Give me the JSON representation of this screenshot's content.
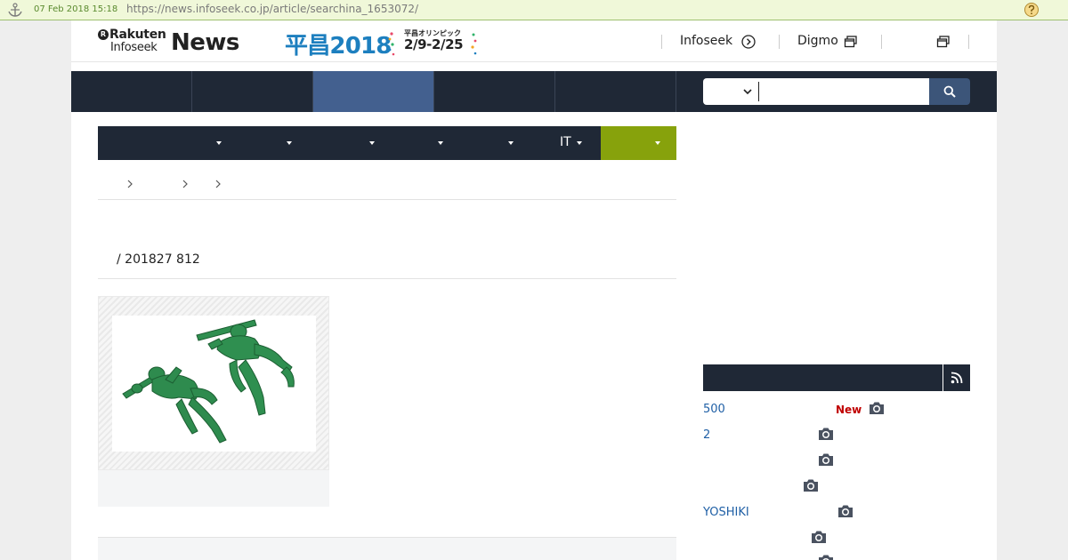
{
  "wayback": {
    "date": "07 Feb 2018 15:18",
    "url": "https://news.infoseek.co.jp/article/searchina_1653072/"
  },
  "header": {
    "logo": {
      "rakuten": "Rakuten",
      "infoseek": "Infoseek",
      "news": "News",
      "badge": "R"
    },
    "olympic": {
      "main": "平昌2018",
      "sub": "平昌オリンピック",
      "dates": "2/9-2/25"
    },
    "links": [
      {
        "label": "Infoseek",
        "icon": "arrow-circle-icon"
      },
      {
        "label": "Digmo",
        "icon": "external-window-icon"
      }
    ],
    "extra_icon": "external-window-icon"
  },
  "nav": {
    "active_index": 2,
    "search": {
      "selected": "",
      "value": ""
    }
  },
  "categories": {
    "visible_label": "IT",
    "dropdown_count": 7
  },
  "article": {
    "meta": "/ 201827 812"
  },
  "ranking": {
    "rss_icon": "rss-icon",
    "items": [
      {
        "title": "500",
        "new": "New"
      },
      {
        "title": "2",
        "new": ""
      },
      {
        "title": "",
        "new": ""
      },
      {
        "title": "",
        "new": ""
      },
      {
        "title": "YOSHIKI",
        "new": ""
      },
      {
        "title": "",
        "new": ""
      },
      {
        "title": "",
        "new": ""
      }
    ]
  },
  "colors": {
    "nav_bg": "#1f2836",
    "nav_active": "#43608f",
    "category_active": "#87a20c",
    "link": "#2060a6",
    "new_badge": "#c00000",
    "olympic_blue": "#1d7fbf"
  }
}
